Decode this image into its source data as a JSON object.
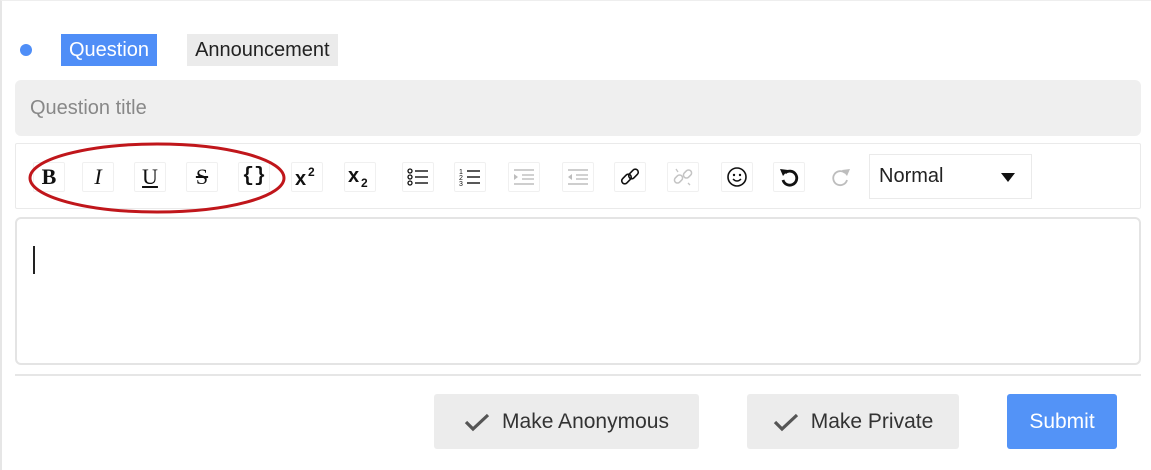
{
  "post_type": {
    "tabs": [
      {
        "label": "Question",
        "active": true
      },
      {
        "label": "Announcement",
        "active": false
      }
    ],
    "accent_color": "#4f8ef7"
  },
  "title_input": {
    "placeholder": "Question title",
    "value": ""
  },
  "toolbar": {
    "buttons": [
      {
        "icon": "bold-icon",
        "label": "B",
        "enabled": true
      },
      {
        "icon": "italic-icon",
        "label": "I",
        "enabled": true
      },
      {
        "icon": "underline-icon",
        "label": "U",
        "enabled": true
      },
      {
        "icon": "strikethrough-icon",
        "label": "S",
        "enabled": true
      },
      {
        "icon": "code-icon",
        "label": "{}",
        "enabled": true
      },
      {
        "icon": "superscript-icon",
        "enabled": true
      },
      {
        "icon": "subscript-icon",
        "enabled": true
      },
      {
        "icon": "bullet-list-icon",
        "enabled": true
      },
      {
        "icon": "numbered-list-icon",
        "enabled": true
      },
      {
        "icon": "indent-icon",
        "enabled": false
      },
      {
        "icon": "outdent-icon",
        "enabled": false
      },
      {
        "icon": "link-icon",
        "enabled": true
      },
      {
        "icon": "unlink-icon",
        "enabled": false
      },
      {
        "icon": "emoji-icon",
        "enabled": true
      },
      {
        "icon": "undo-icon",
        "enabled": true
      },
      {
        "icon": "redo-icon",
        "enabled": false
      }
    ],
    "block_style": {
      "selected": "Normal"
    }
  },
  "annotation": {
    "shape": "ellipse",
    "color": "#c0161b",
    "target": "inline style buttons"
  },
  "editor": {
    "value": ""
  },
  "footer": {
    "anonymous_label": "Make Anonymous",
    "private_label": "Make Private",
    "submit_label": "Submit",
    "submit_color": "#5393f7"
  }
}
